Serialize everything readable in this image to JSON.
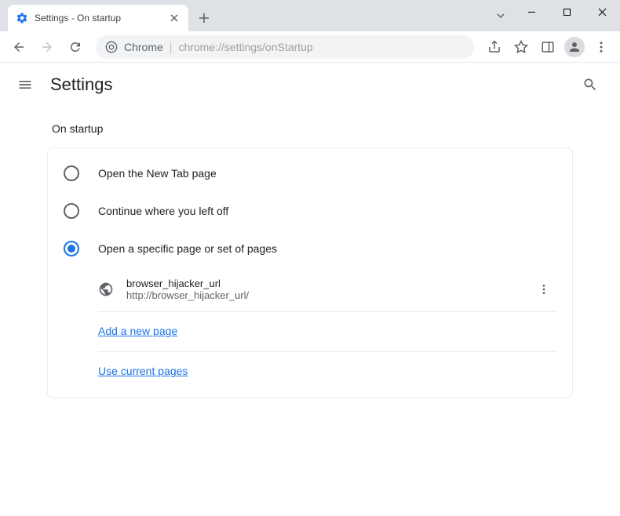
{
  "window": {
    "tab_title": "Settings - On startup"
  },
  "omnibox": {
    "prefix": "Chrome",
    "url": "chrome://settings/onStartup"
  },
  "settings": {
    "header_title": "Settings",
    "section_title": "On startup",
    "options": {
      "new_tab": "Open the New Tab page",
      "continue": "Continue where you left off",
      "specific": "Open a specific page or set of pages"
    },
    "pages": [
      {
        "name": "browser_hijacker_url",
        "url": "http://browser_hijacker_url/"
      }
    ],
    "actions": {
      "add_page": "Add a new page",
      "use_current": "Use current pages"
    }
  }
}
